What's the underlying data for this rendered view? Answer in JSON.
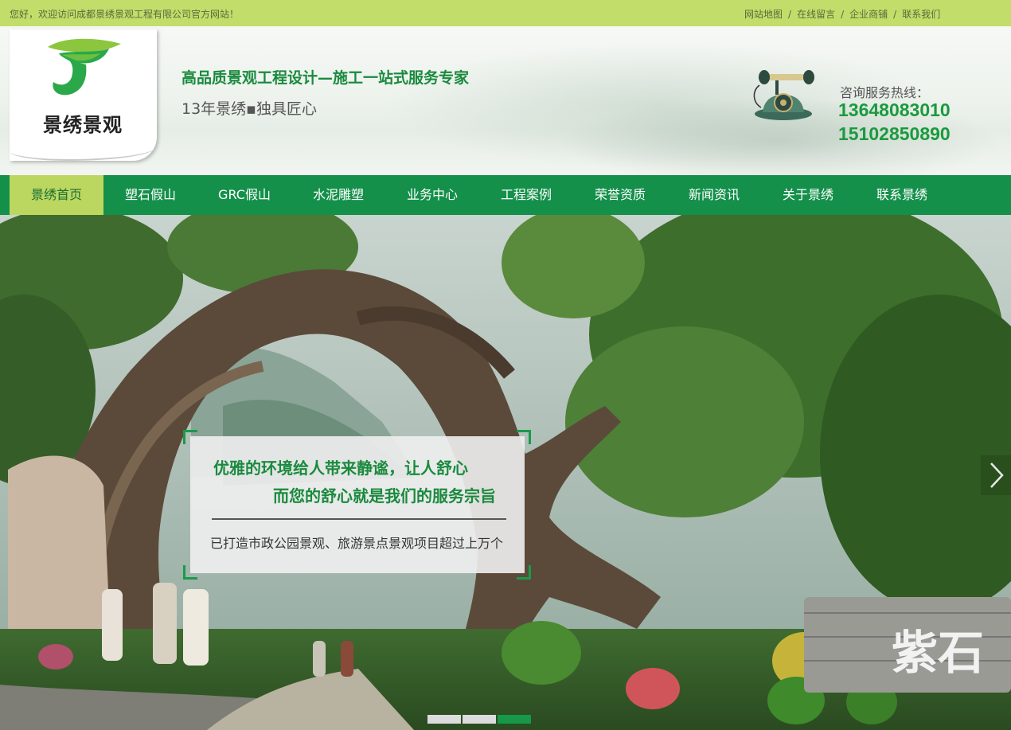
{
  "topbar": {
    "welcome": "您好，欢迎访问成都景绣景观工程有限公司官方网站！",
    "links": [
      "网站地图",
      "在线留言",
      "企业商铺",
      "联系我们"
    ],
    "separator": "/"
  },
  "header": {
    "logo_text": "景绣景观",
    "slogan_main": "高品质景观工程设计—施工一站式服务专家",
    "slogan_sub": "13年景绣▪独具匠心",
    "hotline_label": "咨询服务热线：",
    "hotline_numbers": [
      "13648083010",
      "15102850890"
    ]
  },
  "nav": {
    "items": [
      "景绣首页",
      "塑石假山",
      "GRC假山",
      "水泥雕塑",
      "业务中心",
      "工程案例",
      "荣誉资质",
      "新闻资讯",
      "关于景绣",
      "联系景绣"
    ],
    "active_index": 0
  },
  "banner": {
    "caption_line1": "优雅的环境给人带来静谧，让人舒心",
    "caption_line2": "而您的舒心就是我们的服务宗旨",
    "caption_line3": "已打造市政公园景观、旅游景点景观项目超过上万个",
    "stone_text": "紫石",
    "slide_count": 3,
    "active_slide": 2
  },
  "colors": {
    "brand_green": "#14904a",
    "light_green": "#c2dd6a",
    "active_nav": "#bcd760"
  },
  "icons": {
    "logo": "leaf-j-logo-icon",
    "phone": "vintage-telephone-icon",
    "next": "chevron-right-icon"
  }
}
